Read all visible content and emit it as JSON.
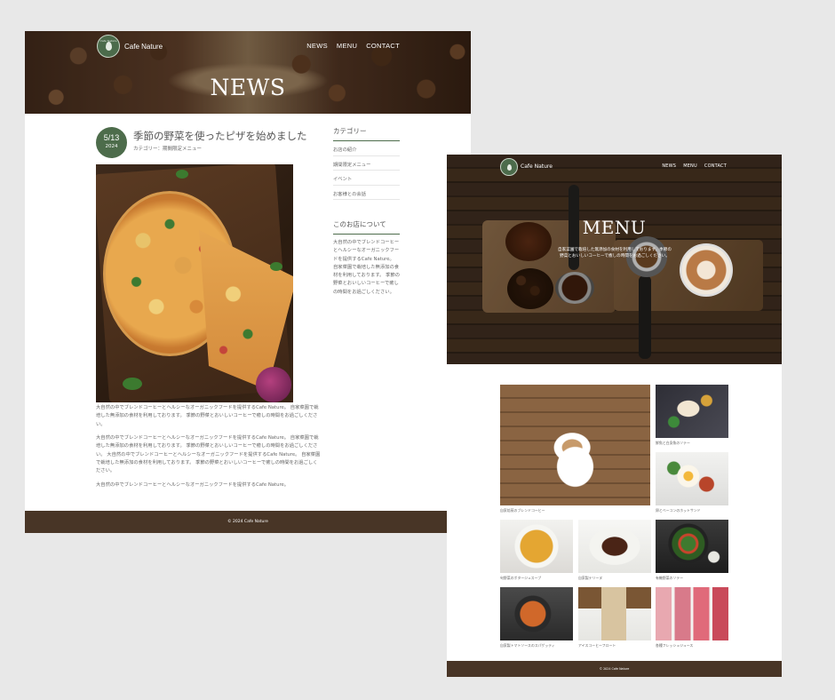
{
  "brand": "Cafe Nature",
  "logo_text": "Cafe Nature",
  "nav": [
    "NEWS",
    "MENU",
    "CONTACT"
  ],
  "news": {
    "hero_title": "NEWS",
    "date": "5/13",
    "year": "2024",
    "post_title": "季節の野菜を使ったピザを始めました",
    "category_line": "カテゴリー：期間限定メニュー",
    "paragraphs": [
      "大自然の中でブレンドコーヒーとヘルシーなオーガニックフードを提供するCafe Nature。 自家菜園で栽培した無添加の食材を利用しております。 季節の野菜とおいしいコーヒーで癒しの時間をお過ごしください。",
      "大自然の中でブレンドコーヒーとヘルシーなオーガニックフードを提供するCafe Nature。 自家菜園で栽培した無添加の食材を利用しております。 季節の野菜とおいしいコーヒーで癒しの時間をお過ごしください。 大自然の中でブレンドコーヒーとヘルシーなオーガニックフードを提供するCafe Nature。 自家菜園で栽培した無添加の食材を利用しております。 季節の野菜とおいしいコーヒーで癒しの時間をお過ごしください。",
      "大自然の中でブレンドコーヒーとヘルシーなオーガニックフードを提供するCafe Nature。"
    ],
    "sidebar": {
      "category_heading": "カテゴリー",
      "categories": [
        "お店の紹介",
        "期間限定メニュー",
        "イベント",
        "お客様との会話"
      ],
      "about_heading": "このお店について",
      "about_text": "大自然の中でブレンドコーヒーとヘルシーなオーガニックフードを提供するCafe Nature。 自家菜園で栽培した無添加の食材を利用しております。 季節の野菜とおいしいコーヒーで癒しの時間をお過ごしください。"
    },
    "footer": "© 2024 Cafe Nature"
  },
  "menu": {
    "hero_title": "MENU",
    "hero_text": "自家菜園で栽培した無添加の食材を利用しております。季節の野菜とおいしいコーヒーで癒しの時間をお過ごしください。",
    "items": [
      "自家焙煎のブレンドコーヒー",
      "鮮魚と白身魚のソテー",
      "卵とベーコンのホットサンド",
      "旬野菜のポタージュスープ",
      "自家製テリーヌ",
      "有機野菜のソテー",
      "自家製トマトソースのスパゲッティ",
      "アイスコーヒーフロート",
      "各種フレッシュジュース"
    ],
    "footer": "© 2024 Cafe Nature"
  },
  "colors": {
    "accent_green": "#4d6c4b",
    "footer_brown": "#483526"
  }
}
